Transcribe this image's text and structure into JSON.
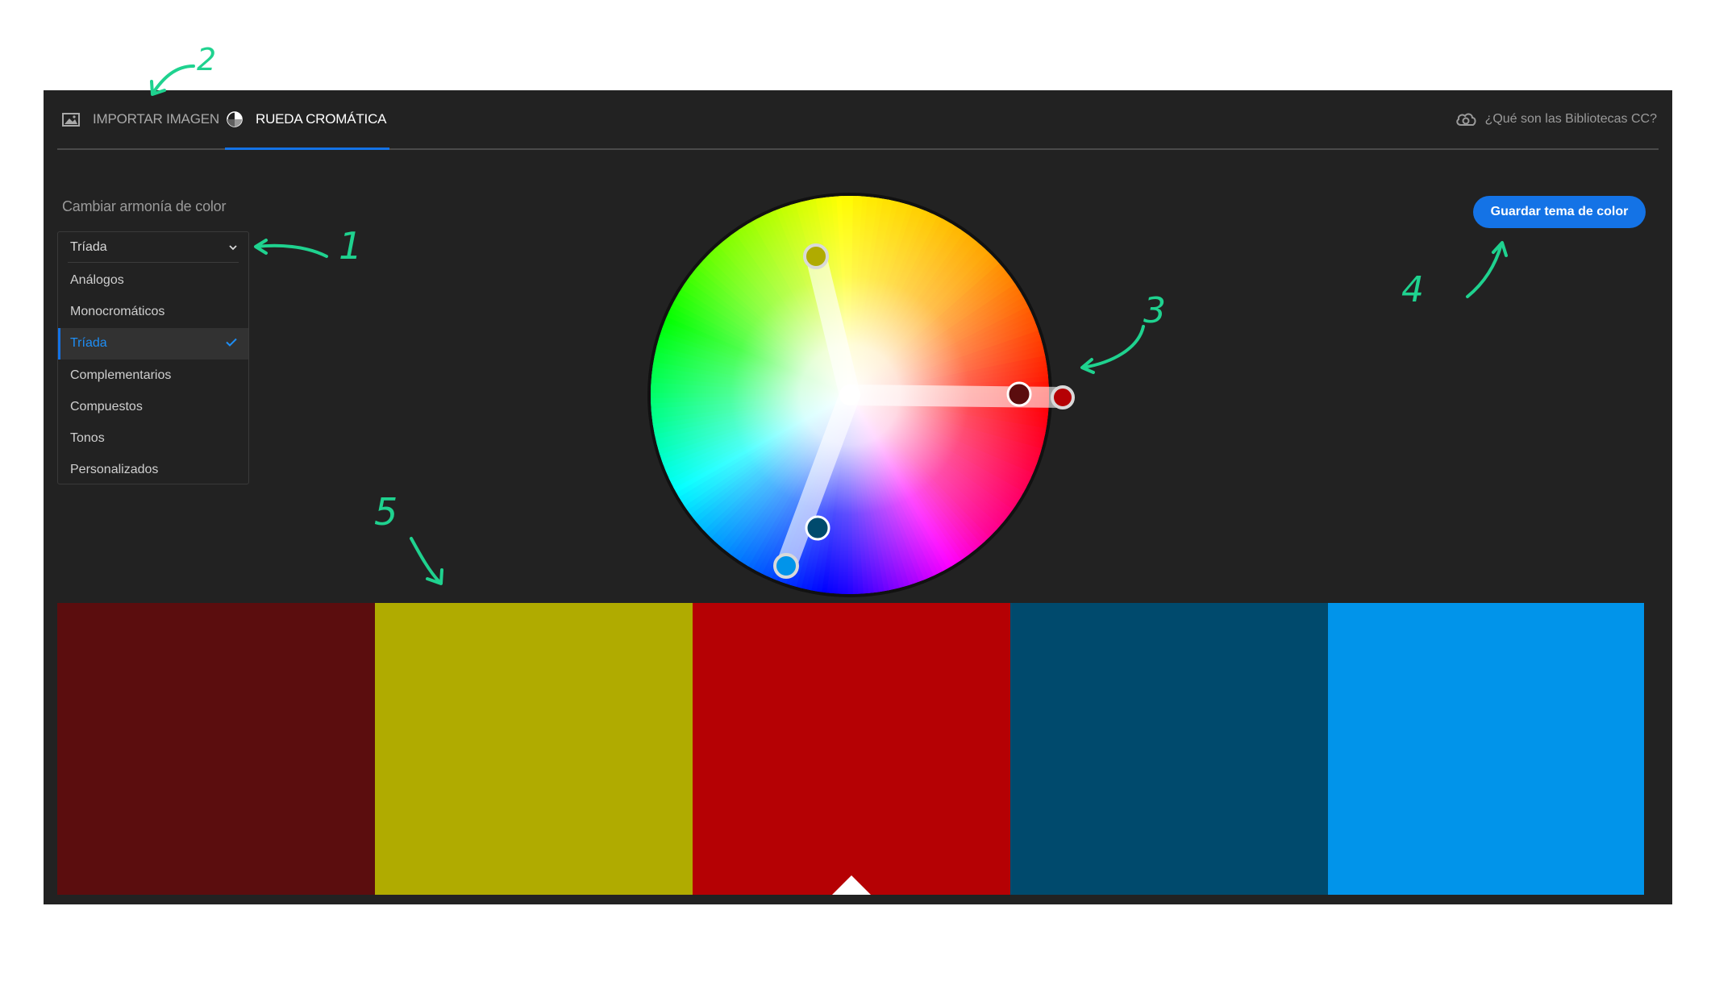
{
  "tabs": [
    {
      "label": "IMPORTAR IMAGEN",
      "icon": "image-icon",
      "active": false
    },
    {
      "label": "RUEDA CROMÁTICA",
      "icon": "color-wheel-icon",
      "active": true
    }
  ],
  "help_link": {
    "label": "¿Qué son las Bibliotecas CC?",
    "icon": "creative-cloud-icon"
  },
  "harmony": {
    "label": "Cambiar armonía de color",
    "selected": "Tríada",
    "options": [
      "Análogos",
      "Monocromáticos",
      "Tríada",
      "Complementarios",
      "Compuestos",
      "Tonos",
      "Personalizados"
    ]
  },
  "save_button": {
    "label": "Guardar tema de color"
  },
  "wheel": {
    "handles": [
      {
        "color": "#5b0d0e"
      },
      {
        "color": "#b0ab00"
      },
      {
        "color": "#b50104"
      },
      {
        "color": "#004a6d"
      },
      {
        "color": "#0194ea"
      }
    ]
  },
  "swatches": [
    {
      "color": "#5b0d0e"
    },
    {
      "color": "#b0ab00"
    },
    {
      "color": "#b50104",
      "active": true
    },
    {
      "color": "#004a6d"
    },
    {
      "color": "#0194ea"
    }
  ],
  "annotations": [
    "1",
    "2",
    "3",
    "4",
    "5"
  ],
  "colors": {
    "accent": "#1473e6",
    "annotation": "#1fd28f",
    "background": "#222222"
  }
}
